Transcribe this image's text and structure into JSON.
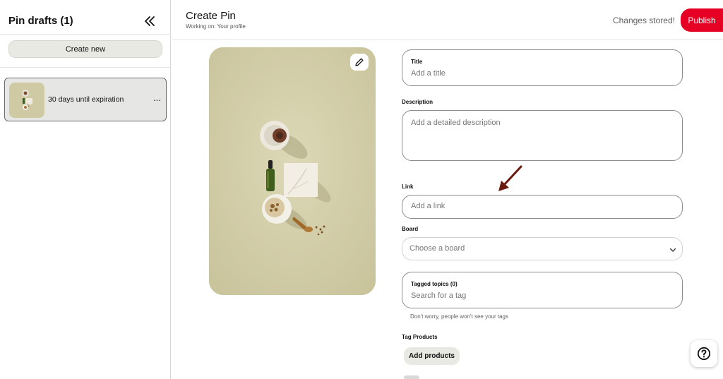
{
  "sidebar": {
    "title": "Pin drafts (1)",
    "collapse_icon": "double-chevron-left-icon",
    "create_new_label": "Create new",
    "drafts": [
      {
        "label": "30 days until expiration",
        "more_icon": "ellipsis-icon",
        "more_label": "···"
      }
    ]
  },
  "header": {
    "title": "Create Pin",
    "subtitle": "Working on: Your profile",
    "status": "Changes stored!",
    "publish_label": "Publish"
  },
  "image": {
    "edit_icon": "pencil-icon",
    "background_color": "#d2cea8"
  },
  "form": {
    "title": {
      "label": "Title",
      "placeholder": "Add a title"
    },
    "description": {
      "label": "Description",
      "placeholder": "Add a detailed description"
    },
    "link": {
      "label": "Link",
      "placeholder": "Add a link"
    },
    "board": {
      "label": "Board",
      "value": "Choose a board",
      "icon": "chevron-down-icon"
    },
    "tagged_topics": {
      "label": "Tagged topics (0)",
      "placeholder": "Search for a tag",
      "helper": "Don't worry, people won't see your tags"
    },
    "tag_products": {
      "label": "Tag Products",
      "button_label": "Add products"
    }
  },
  "help": {
    "icon": "question-circle-icon"
  },
  "colors": {
    "accent": "#e60023",
    "annotation_arrow": "#6b1a10"
  }
}
